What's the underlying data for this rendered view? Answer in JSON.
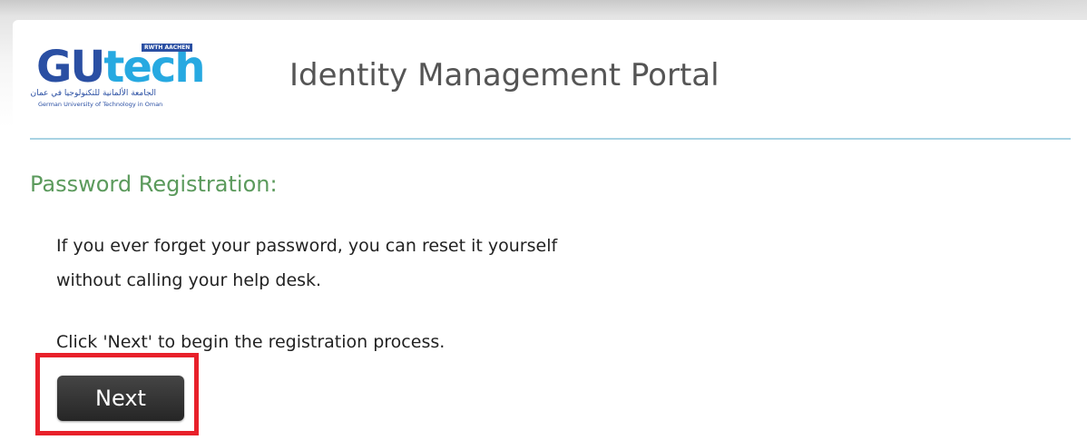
{
  "logo": {
    "main_gu": "GU",
    "main_tech": "tech",
    "badge": "RWTH AACHEN",
    "arabic": "الجامعة الألمانية للتكنولوجيا في عمان",
    "english": "German University of Technology in Oman"
  },
  "header": {
    "title": "Identity Management Portal"
  },
  "section": {
    "title": "Password Registration:"
  },
  "content": {
    "line1": "If you ever forget your password, you can reset it yourself",
    "line2": "without calling your help desk.",
    "line3": "Click 'Next' to begin the registration process."
  },
  "actions": {
    "next_label": "Next"
  },
  "colors": {
    "accent_green": "#5b9a5c",
    "divider_blue": "#a9d3e3",
    "highlight_red": "#e8202a",
    "logo_blue": "#2a4fa3",
    "logo_light_blue": "#27a9e1"
  }
}
